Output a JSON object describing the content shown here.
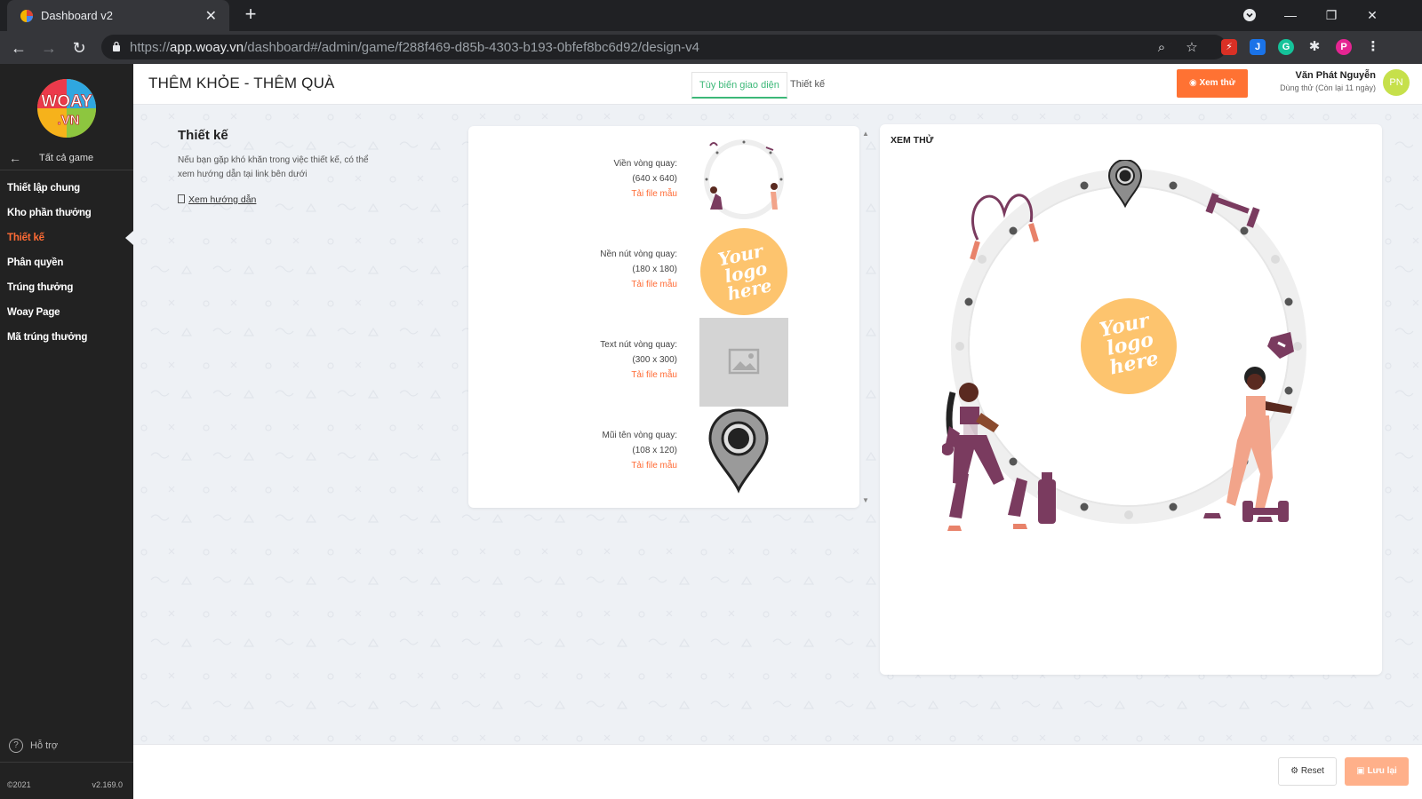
{
  "browser": {
    "tab_title": "Dashboard v2",
    "url_scheme": "https://",
    "url_host": "app.woay.vn",
    "url_path": "/dashboard#/admin/game/f288f469-d85b-4303-b193-0bfef8bc6d92/design-v4",
    "profile_initial": "P"
  },
  "sidebar": {
    "logo_text_top": "WOAY",
    "logo_text_bottom": ".VN",
    "back_label": "Tất cả game",
    "items": [
      {
        "label": "Thiết lập chung"
      },
      {
        "label": "Kho phần thưởng"
      },
      {
        "label": "Thiết kế"
      },
      {
        "label": "Phân quyền"
      },
      {
        "label": "Trúng thưởng"
      },
      {
        "label": "Woay Page"
      },
      {
        "label": "Mã trúng thưởng"
      }
    ],
    "active_index": 2,
    "support_label": "Hỗ trợ",
    "copyright": "©2021",
    "version": "v2.169.0"
  },
  "header": {
    "game_title": "THÊM KHỎE - THÊM QUÀ",
    "tabs": [
      {
        "label": "Tùy biến giao diện",
        "active": true
      },
      {
        "label": "Thiết kế",
        "active": false
      }
    ],
    "preview_button": "Xem thử",
    "user_name": "Văn Phát Nguyễn",
    "user_status": "Dùng thử (Còn lại 11 ngày)",
    "avatar_initials": "PN"
  },
  "design_info": {
    "heading": "Thiết kế",
    "description": "Nếu bạn gặp khó khăn trong việc thiết kế, có thể xem hướng dẫn tại link bên dưới",
    "guide_link": "Xem hướng dẫn"
  },
  "assets": [
    {
      "name": "Viền vòng quay:",
      "size": "(640 x 640)",
      "download": "Tải file mẫu"
    },
    {
      "name": "Nền nút vòng quay:",
      "size": "(180 x 180)",
      "download": "Tải file mẫu"
    },
    {
      "name": "Text nút vòng quay:",
      "size": "(300 x 300)",
      "download": "Tải file mẫu"
    },
    {
      "name": "Mũi tên vòng quay:",
      "size": "(108 x 120)",
      "download": "Tải file mẫu"
    }
  ],
  "logo_placeholder_text": [
    "Your",
    "logo",
    "here"
  ],
  "preview": {
    "label": "XEM THỬ"
  },
  "footer": {
    "reset_label": "Reset",
    "save_label": "Lưu lại"
  },
  "colors": {
    "accent_orange": "#ff7233",
    "active_tab_green": "#3cb878",
    "sidebar_bg": "#222222",
    "logo_circle": "#fdc46e",
    "fitness_purple": "#7a3b5f"
  }
}
